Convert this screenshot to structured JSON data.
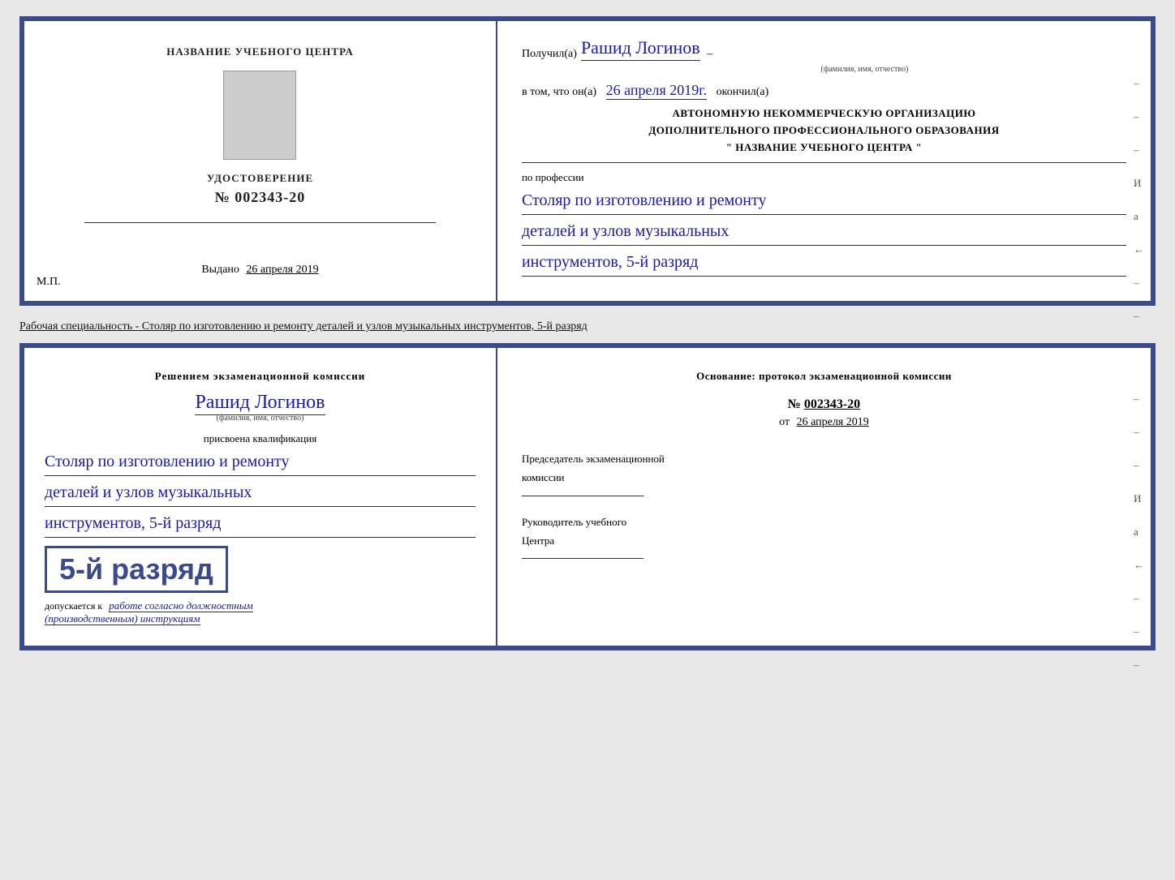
{
  "page": {
    "background": "#e8e8e8"
  },
  "top_cert": {
    "left": {
      "org_name_label": "НАЗВАНИЕ УЧЕБНОГО ЦЕНТРА",
      "cert_type": "УДОСТОВЕРЕНИЕ",
      "cert_number_prefix": "№",
      "cert_number": "002343-20",
      "issued_label": "Выдано",
      "issued_date": "26 апреля 2019",
      "mp_label": "М.П."
    },
    "right": {
      "received_label": "Получил(а)",
      "recipient_name": "Рашид Логинов",
      "fio_subtitle": "(фамилия, имя, отчество)",
      "in_that_label": "в том, что он(а)",
      "date_handwritten": "26 апреля 2019г.",
      "finished_label": "окончил(а)",
      "org_line1": "АВТОНОМНУЮ НЕКОММЕРЧЕСКУЮ ОРГАНИЗАЦИЮ",
      "org_line2": "ДОПОЛНИТЕЛЬНОГО ПРОФЕССИОНАЛЬНОГО ОБРАЗОВАНИЯ",
      "org_line3": "\"  НАЗВАНИЕ УЧЕБНОГО ЦЕНТРА  \"",
      "profession_label": "по профессии",
      "profession_line1": "Столяр по изготовлению и ремонту",
      "profession_line2": "деталей и узлов музыкальных",
      "profession_line3": "инструментов, 5-й разряд"
    }
  },
  "specialty_label": "Рабочая специальность - Столяр по изготовлению и ремонту деталей и узлов музыкальных инструментов, 5-й разряд",
  "bottom_cert": {
    "left": {
      "decision_line1": "Решением экзаменационной комиссии",
      "person_name": "Рашид Логинов",
      "fio_subtitle": "(фамилия, имя, отчество)",
      "qualification_assigned": "присвоена квалификация",
      "qual_line1": "Столяр по изготовлению и ремонту",
      "qual_line2": "деталей и узлов музыкальных",
      "qual_line3": "инструментов, 5-й разряд",
      "rank_text": "5-й разряд",
      "admitted_label": "допускается к",
      "admitted_text": "работе согласно должностным",
      "admitted_text2": "(производственным) инструкциям"
    },
    "right": {
      "basis_label": "Основание: протокол экзаменационной комиссии",
      "protocol_prefix": "№",
      "protocol_number": "002343-20",
      "date_prefix": "от",
      "date_value": "26 апреля 2019",
      "chairman_label": "Председатель экзаменационной",
      "chairman_label2": "комиссии",
      "head_label": "Руководитель учебного",
      "head_label2": "Центра"
    }
  },
  "dashes": [
    "-",
    "-",
    "-",
    "И",
    "а",
    "←",
    "-",
    "-",
    "-"
  ]
}
